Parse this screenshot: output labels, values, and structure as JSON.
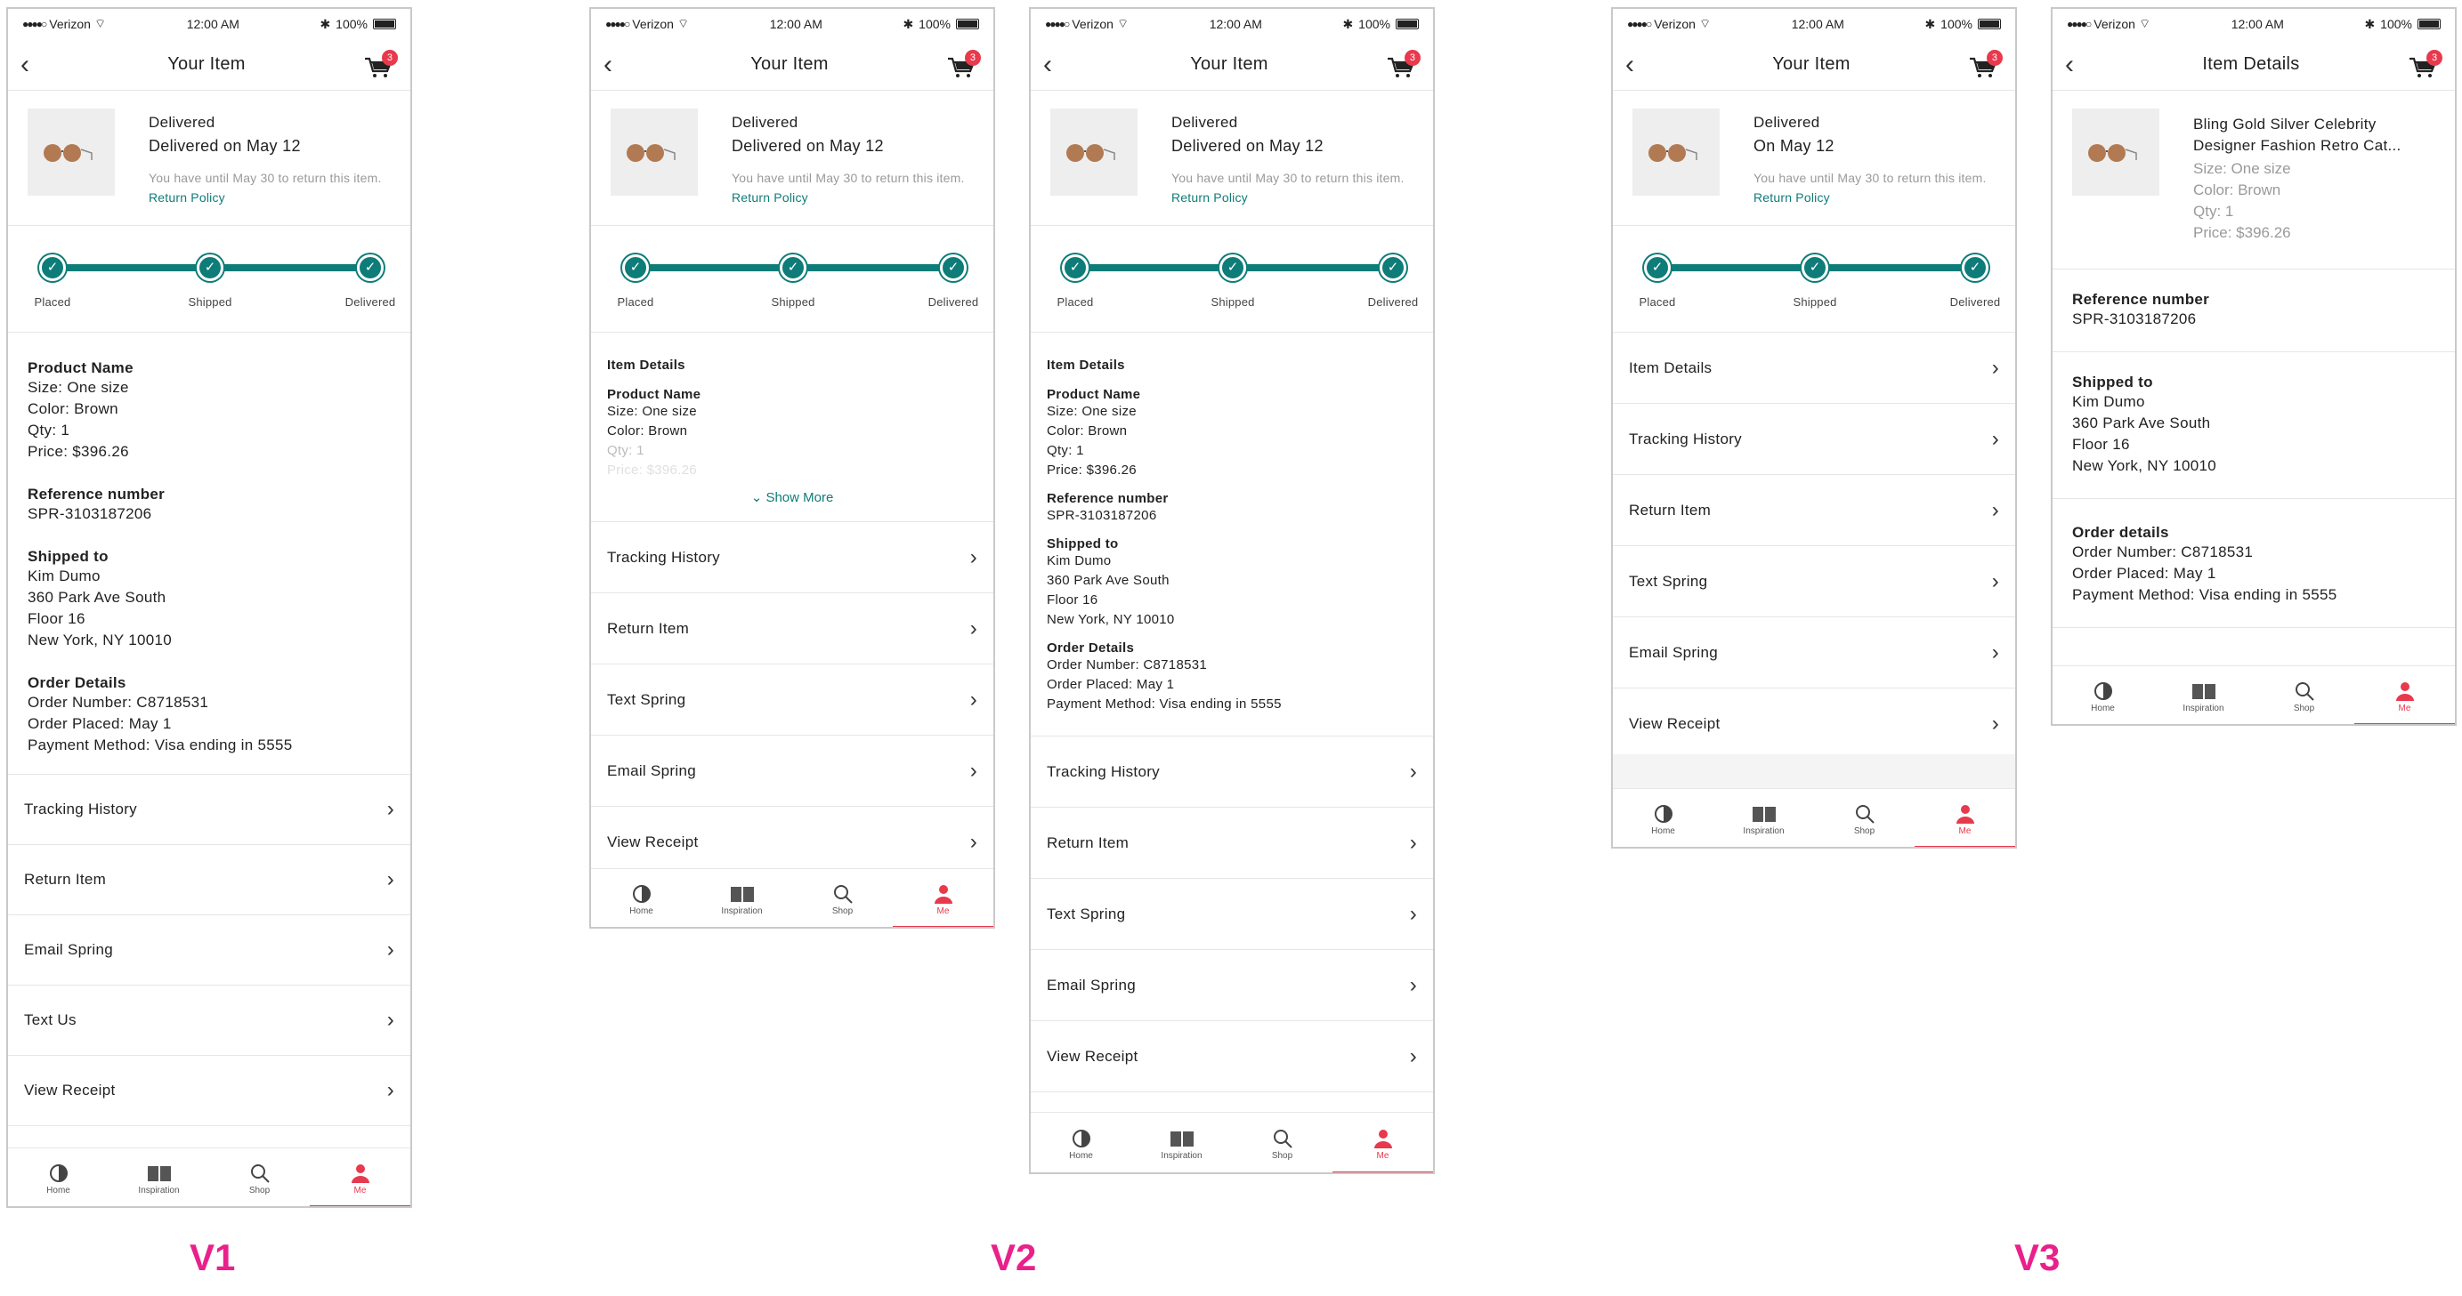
{
  "status": {
    "carrier": "Verizon",
    "time": "12:00 AM",
    "battery": "100%"
  },
  "cart_count": "3",
  "tabs": [
    {
      "label": "Home",
      "icon": "home-icon"
    },
    {
      "label": "Inspiration",
      "icon": "book-icon"
    },
    {
      "label": "Shop",
      "icon": "search-icon"
    },
    {
      "label": "Me",
      "icon": "person-icon"
    }
  ],
  "colors": {
    "accent": "#0e7c78",
    "active": "#e8394d",
    "version_label": "#e8218b"
  },
  "tracking_labels": [
    "Placed",
    "Shipped",
    "Delivered"
  ],
  "return_note": "You have until May 30 to return this item.",
  "return_link": "Return Policy",
  "labels": {
    "v1": "V1",
    "v2": "V2",
    "v3": "V3"
  },
  "v1": {
    "title": "Your Item",
    "status": "Delivered",
    "date": "Delivered on May 12",
    "product_name": "Product Name",
    "size": "Size: One size",
    "color": "Color: Brown",
    "qty": "Qty: 1",
    "price": "Price: $396.26",
    "ref_label": "Reference number",
    "ref": "SPR-3103187206",
    "ship_label": "Shipped to",
    "ship": [
      "Kim Dumo",
      "360 Park Ave South",
      "Floor 16",
      "New York, NY 10010"
    ],
    "order_label": "Order Details",
    "order": [
      "Order Number: C8718531",
      "Order Placed: May 1",
      "Payment Method: Visa ending in 5555"
    ],
    "rows": [
      "Tracking History",
      "Return Item",
      "Email Spring",
      "Text Us",
      "View Receipt"
    ]
  },
  "v2a": {
    "title": "Your Item",
    "status": "Delivered",
    "date": "Delivered on May 12",
    "section": "Item Details",
    "product_name": "Product Name",
    "size": "Size: One size",
    "color": "Color: Brown",
    "qty": "Qty: 1",
    "price": "Price: $396.26",
    "show_more": "Show More",
    "rows": [
      "Tracking History",
      "Return Item",
      "Text Spring",
      "Email Spring",
      "View Receipt"
    ]
  },
  "v2b": {
    "title": "Your Item",
    "status": "Delivered",
    "date": "Delivered on May 12",
    "section": "Item Details",
    "product_name": "Product Name",
    "size": "Size: One size",
    "color": "Color: Brown",
    "qty": "Qty: 1",
    "price": "Price: $396.26",
    "ref_label": "Reference number",
    "ref": "SPR-3103187206",
    "ship_label": "Shipped to",
    "ship": [
      "Kim Dumo",
      "360 Park Ave South",
      "Floor 16",
      "New York, NY 10010"
    ],
    "order_label": "Order Details",
    "order": [
      "Order Number: C8718531",
      "Order Placed: May 1",
      "Payment Method: Visa ending in 5555"
    ],
    "rows": [
      "Tracking History",
      "Return Item",
      "Text Spring",
      "Email Spring",
      "View Receipt"
    ]
  },
  "v3a": {
    "title": "Your Item",
    "status": "Delivered",
    "date": "On May 12",
    "rows": [
      "Item Details",
      "Tracking History",
      "Return Item",
      "Text Spring",
      "Email Spring",
      "View Receipt"
    ]
  },
  "v3b": {
    "title": "Item Details",
    "name": "Bling Gold Silver Celebrity Designer Fashion Retro Cat...",
    "size": "Size: One size",
    "color": "Color: Brown",
    "qty": "Qty: 1",
    "price": "Price: $396.26",
    "ref_label": "Reference number",
    "ref": "SPR-3103187206",
    "ship_label": "Shipped to",
    "ship": [
      "Kim Dumo",
      "360 Park Ave South",
      "Floor 16",
      "New York, NY 10010"
    ],
    "order_label": "Order details",
    "order": [
      "Order Number: C8718531",
      "Order Placed: May 1",
      "Payment Method: Visa ending in 5555"
    ]
  }
}
